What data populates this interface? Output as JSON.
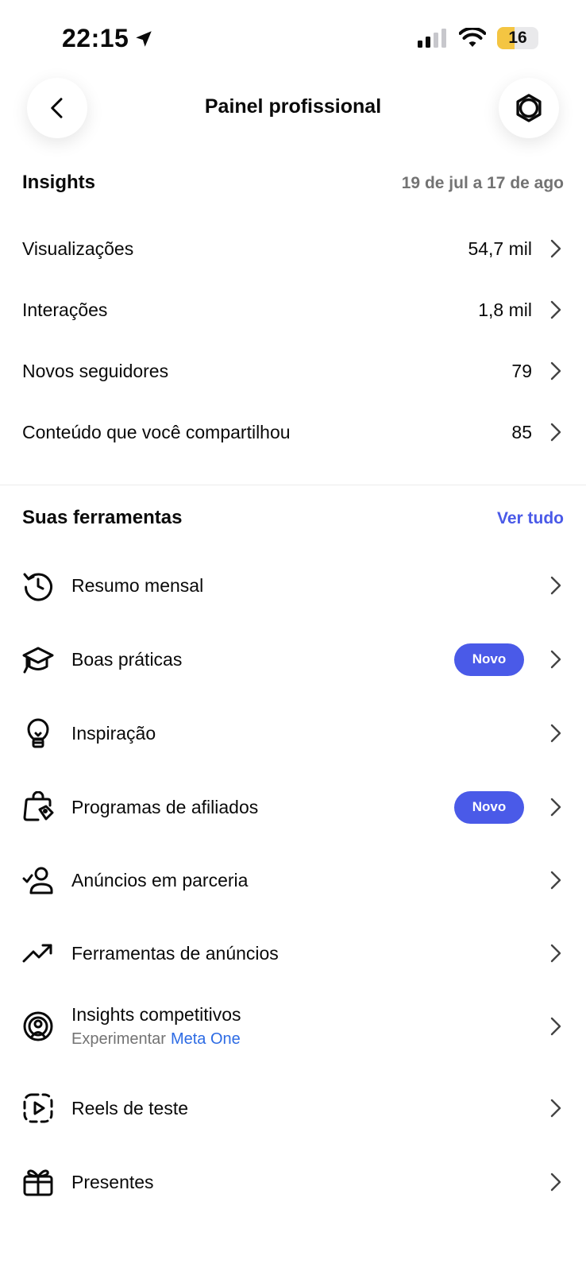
{
  "status_bar": {
    "time": "22:15",
    "battery": "16",
    "battery_level": 0.16
  },
  "header": {
    "title": "Painel profissional"
  },
  "insights": {
    "title": "Insights",
    "date_range": "19 de jul a 17 de ago",
    "metrics": [
      {
        "label": "Visualizações",
        "value": "54,7 mil"
      },
      {
        "label": "Interações",
        "value": "1,8 mil"
      },
      {
        "label": "Novos seguidores",
        "value": "79"
      },
      {
        "label": "Conteúdo que você compartilhou",
        "value": "85"
      }
    ]
  },
  "tools": {
    "title": "Suas ferramentas",
    "see_all": "Ver tudo",
    "items": [
      {
        "label": "Resumo mensal",
        "icon": "history-icon"
      },
      {
        "label": "Boas práticas",
        "icon": "graduation-cap-icon",
        "badge": "Novo"
      },
      {
        "label": "Inspiração",
        "icon": "lightbulb-icon"
      },
      {
        "label": "Programas de afiliados",
        "icon": "shopping-bag-tag-icon",
        "badge": "Novo"
      },
      {
        "label": "Anúncios em parceria",
        "icon": "user-check-icon"
      },
      {
        "label": "Ferramentas de anúncios",
        "icon": "trending-up-icon"
      },
      {
        "label": "Insights competitivos",
        "icon": "user-radar-icon",
        "sub": "Experimentar",
        "sub_link": "Meta One"
      },
      {
        "label": "Reels de teste",
        "icon": "dashed-play-icon"
      },
      {
        "label": "Presentes",
        "icon": "gift-icon"
      }
    ]
  },
  "colors": {
    "accent": "#4a5ae8",
    "link": "#2d6be4",
    "muted": "#737373"
  }
}
